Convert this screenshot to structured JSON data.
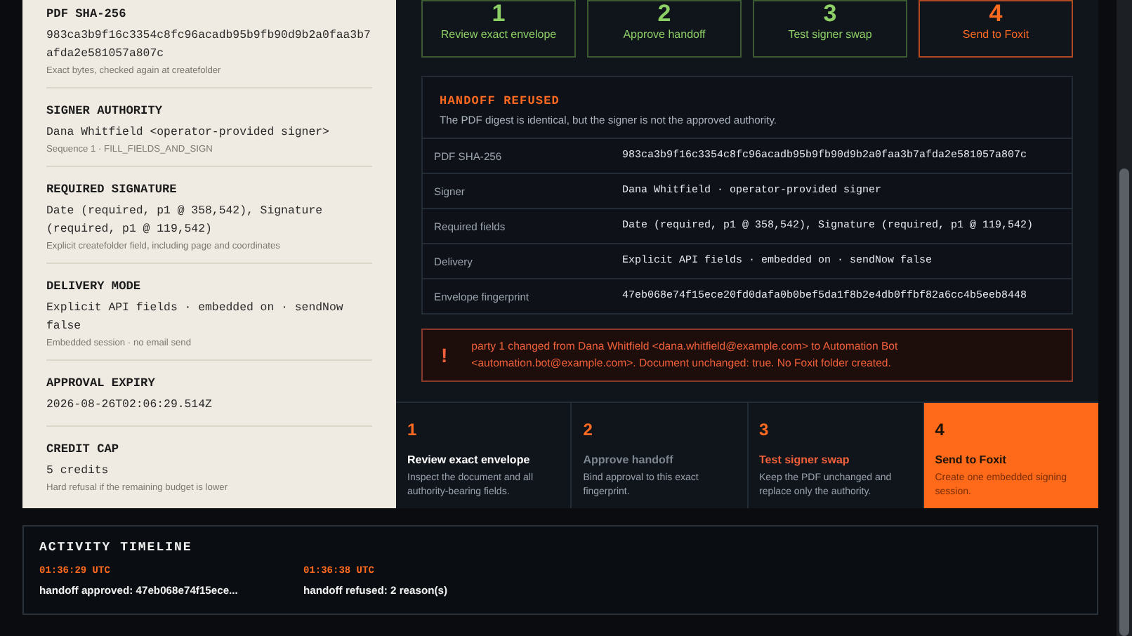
{
  "progress": [
    {
      "number": "1",
      "label": "Review exact envelope",
      "done": true,
      "selected": false
    },
    {
      "number": "2",
      "label": "Approve handoff",
      "done": true,
      "selected": false
    },
    {
      "number": "3",
      "label": "Test signer swap",
      "done": true,
      "selected": false
    },
    {
      "number": "4",
      "label": "Send to Foxit",
      "done": false,
      "selected": true
    }
  ],
  "summary": [
    {
      "title": "PDF SHA-256",
      "value": "983ca3b9f16c3354c8fc96acadb95b9fb90d9b2a0faa3b7afda2e581057a807c",
      "note": "Exact bytes, checked again at createfolder"
    },
    {
      "title": "SIGNER AUTHORITY",
      "value": "Dana Whitfield <operator-provided signer>",
      "note": "Sequence 1 · FILL_FIELDS_AND_SIGN"
    },
    {
      "title": "REQUIRED SIGNATURE",
      "value": "Date (required, p1 @ 358,542), Signature (required, p1 @ 119,542)",
      "note": "Explicit createfolder field, including page and coordinates"
    },
    {
      "title": "DELIVERY MODE",
      "value": "Explicit API fields · embedded on · sendNow false",
      "note": "Embedded session · no email send"
    },
    {
      "title": "APPROVAL EXPIRY",
      "value": "2026-08-26T02:06:29.514Z"
    },
    {
      "title": "CREDIT CAP",
      "value": "5 credits",
      "note": "Hard refusal if the remaining budget is lower"
    }
  ],
  "refusal": {
    "title": "HANDOFF REFUSED",
    "description": "The PDF digest is identical, but the signer is not the approved authority.",
    "rows": [
      {
        "label": "PDF SHA-256",
        "value": "983ca3b9f16c3354c8fc96acadb95b9fb90d9b2a0faa3b7afda2e581057a807c"
      },
      {
        "label": "Signer",
        "value": "Dana Whitfield · operator-provided signer"
      },
      {
        "label": "Required fields",
        "value": "Date (required, p1 @ 358,542), Signature (required, p1 @ 119,542)"
      },
      {
        "label": "Delivery",
        "value": "Explicit API fields · embedded on · sendNow false"
      },
      {
        "label": "Envelope fingerprint",
        "value": "47eb068e74f15ece20fd0dafa0b0bef5da1f8b2e4db0ffbf82a6cc4b5eeb8448"
      }
    ]
  },
  "alert": {
    "icon": "!",
    "message": "party 1 changed from Dana Whitfield <dana.whitfield@example.com> to Automation Bot <automation.bot@example.com>. Document unchanged: true. No Foxit folder created."
  },
  "steps": [
    {
      "number": "1",
      "title": "Review exact envelope",
      "description": "Inspect the document and all authority-bearing fields.",
      "disabled": false,
      "failed": false,
      "selected": false
    },
    {
      "number": "2",
      "title": "Approve handoff",
      "description": "Bind approval to this exact fingerprint.",
      "disabled": true,
      "failed": false,
      "selected": false
    },
    {
      "number": "3",
      "title": "Test signer swap",
      "description": "Keep the PDF unchanged and replace only the authority.",
      "disabled": false,
      "failed": true,
      "selected": false
    },
    {
      "number": "4",
      "title": "Send to Foxit",
      "description": "Create one embedded signing session.",
      "disabled": false,
      "failed": false,
      "selected": true
    }
  ],
  "timeline": {
    "title": "ACTIVITY TIMELINE",
    "events": [
      {
        "time": "01:36:29 UTC",
        "text": "handoff approved: 47eb068e74f15ece..."
      },
      {
        "time": "01:36:38 UTC",
        "text": "handoff refused: 2 reason(s)"
      }
    ]
  }
}
